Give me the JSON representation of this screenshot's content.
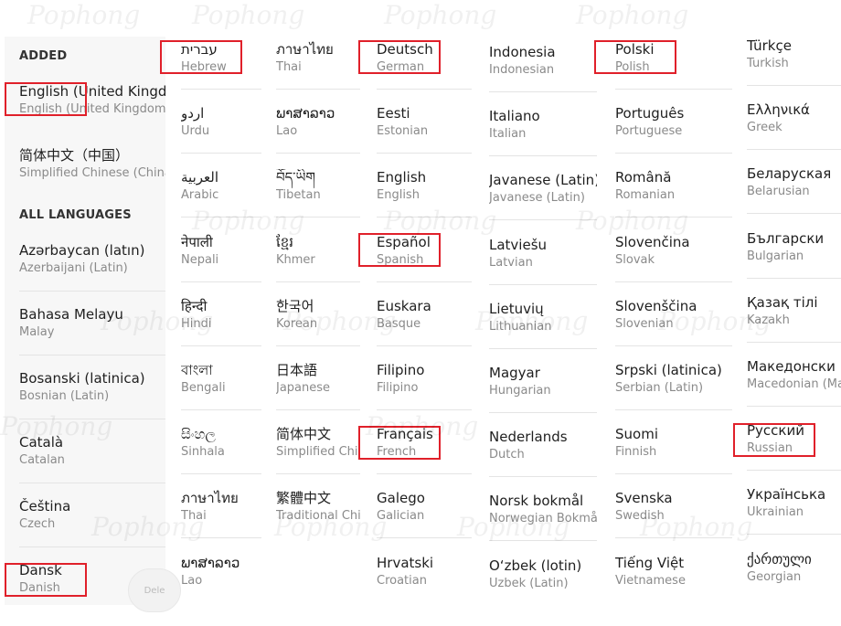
{
  "watermark": "Pophong",
  "sections": {
    "added": "ADDED",
    "all_languages": "ALL LANGUAGES"
  },
  "ghost_button_label": "Dele",
  "col1": {
    "added": [
      {
        "native": "English (United Kingdom)",
        "english": "English (United Kingdom)"
      },
      {
        "native": "简体中文（中国）",
        "english": "Simplified Chinese (China)"
      }
    ],
    "all": [
      {
        "native": "Azərbaycan (latın)",
        "english": "Azerbaijani (Latin)"
      },
      {
        "native": "Bahasa Melayu",
        "english": "Malay"
      },
      {
        "native": "Bosanski (latinica)",
        "english": "Bosnian (Latin)"
      },
      {
        "native": "Català",
        "english": "Catalan"
      },
      {
        "native": "Čeština",
        "english": "Czech"
      },
      {
        "native": "Dansk",
        "english": "Danish"
      }
    ]
  },
  "col2": [
    {
      "native": "עברית",
      "english": "Hebrew"
    },
    {
      "native": "اردو",
      "english": "Urdu"
    },
    {
      "native": "العربية",
      "english": "Arabic"
    },
    {
      "native": "नेपाली",
      "english": "Nepali"
    },
    {
      "native": "हिन्दी",
      "english": "Hindi"
    },
    {
      "native": "বাংলা",
      "english": "Bengali"
    },
    {
      "native": "සිංහල",
      "english": "Sinhala"
    },
    {
      "native": "ภาษาไทย",
      "english": "Thai"
    },
    {
      "native": "ພາສາລາວ",
      "english": "Lao"
    }
  ],
  "col3": [
    {
      "native": "ภาษาไทย",
      "english": "Thai"
    },
    {
      "native": "ພາສາລາວ",
      "english": "Lao"
    },
    {
      "native": "བོད་ཡིག",
      "english": "Tibetan"
    },
    {
      "native": "ខ្មែរ",
      "english": "Khmer"
    },
    {
      "native": "한국어",
      "english": "Korean"
    },
    {
      "native": "日本語",
      "english": "Japanese"
    },
    {
      "native": "简体中文",
      "english": "Simplified Chinese"
    },
    {
      "native": "繁體中文",
      "english": "Traditional Chinese"
    }
  ],
  "col4": [
    {
      "native": "Deutsch",
      "english": "German"
    },
    {
      "native": "Eesti",
      "english": "Estonian"
    },
    {
      "native": "English",
      "english": "English"
    },
    {
      "native": "Español",
      "english": "Spanish"
    },
    {
      "native": "Euskara",
      "english": "Basque"
    },
    {
      "native": "Filipino",
      "english": "Filipino"
    },
    {
      "native": "Français",
      "english": "French"
    },
    {
      "native": "Galego",
      "english": "Galician"
    },
    {
      "native": "Hrvatski",
      "english": "Croatian"
    }
  ],
  "col5": [
    {
      "native": "Indonesia",
      "english": "Indonesian"
    },
    {
      "native": "Italiano",
      "english": "Italian"
    },
    {
      "native": "Javanese (Latin)",
      "english": "Javanese (Latin)"
    },
    {
      "native": "Latviešu",
      "english": "Latvian"
    },
    {
      "native": "Lietuvių",
      "english": "Lithuanian"
    },
    {
      "native": "Magyar",
      "english": "Hungarian"
    },
    {
      "native": "Nederlands",
      "english": "Dutch"
    },
    {
      "native": "Norsk bokmål",
      "english": "Norwegian Bokmål"
    },
    {
      "native": "O‘zbek (lotin)",
      "english": "Uzbek (Latin)"
    }
  ],
  "col6": [
    {
      "native": "Polski",
      "english": "Polish"
    },
    {
      "native": "Português",
      "english": "Portuguese"
    },
    {
      "native": "Română",
      "english": "Romanian"
    },
    {
      "native": "Slovenčina",
      "english": "Slovak"
    },
    {
      "native": "Slovenščina",
      "english": "Slovenian"
    },
    {
      "native": "Srpski (latinica)",
      "english": "Serbian (Latin)"
    },
    {
      "native": "Suomi",
      "english": "Finnish"
    },
    {
      "native": "Svenska",
      "english": "Swedish"
    },
    {
      "native": "Tiếng Việt",
      "english": "Vietnamese"
    }
  ],
  "col7": [
    {
      "native": "Türkçe",
      "english": "Turkish"
    },
    {
      "native": "Ελληνικά",
      "english": "Greek"
    },
    {
      "native": "Беларуская",
      "english": "Belarusian"
    },
    {
      "native": "Български",
      "english": "Bulgarian"
    },
    {
      "native": "Қазақ тілі",
      "english": "Kazakh"
    },
    {
      "native": "Македонски",
      "english": "Macedonian (Macedonia)"
    },
    {
      "native": "Русский",
      "english": "Russian"
    },
    {
      "native": "Українська",
      "english": "Ukrainian"
    },
    {
      "native": "ქართული",
      "english": "Georgian"
    }
  ],
  "highlight_color": "#e0202a"
}
